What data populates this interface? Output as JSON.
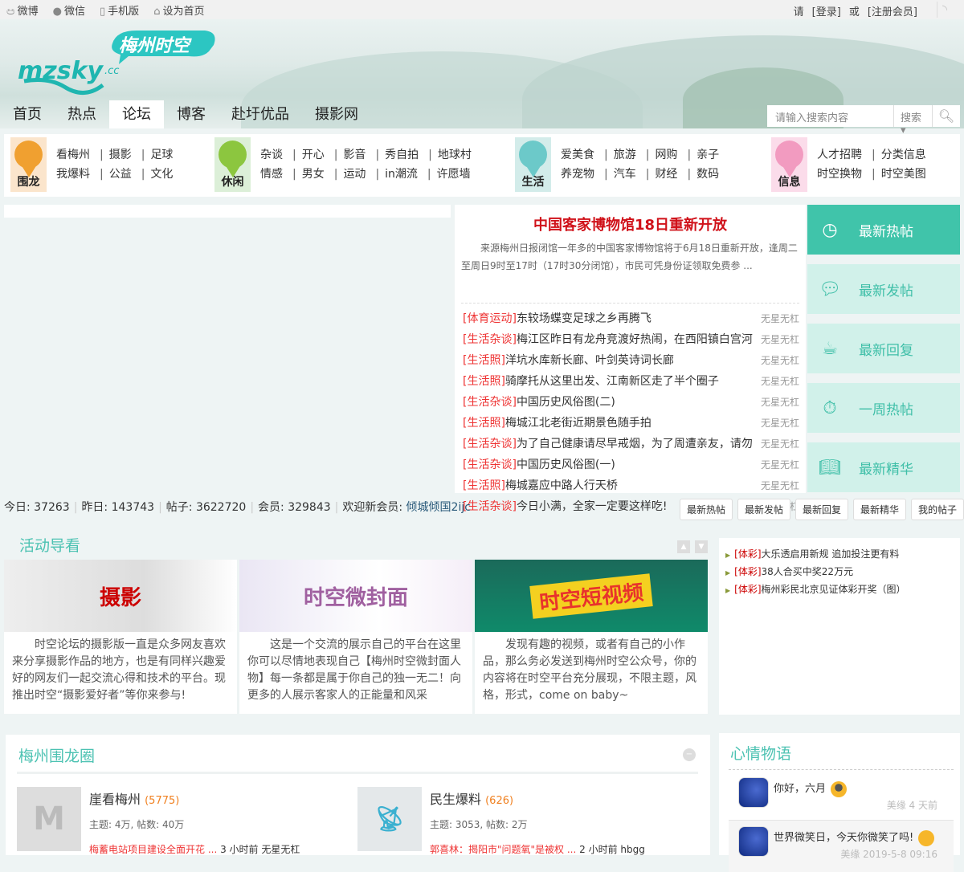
{
  "topbar": {
    "links": [
      "微博",
      "微信",
      "手机版",
      "设为首页"
    ],
    "icons": [
      "weibo-icon",
      "wechat-icon",
      "mobile-icon",
      "home-icon"
    ],
    "login_pre": "请",
    "login": "[登录]",
    "or": "或",
    "register": "[注册会员]"
  },
  "logo": {
    "text": "mzsky",
    "domain": ".cc",
    "cn": "梅州时空"
  },
  "nav": [
    "首页",
    "热点",
    "论坛",
    "博客",
    "赴圩优品",
    "摄影网"
  ],
  "search": {
    "placeholder": "请输入搜索内容",
    "type": "搜索"
  },
  "categories": [
    {
      "label": "围龙",
      "color": "#f0a030",
      "bg": "#fbe5cc",
      "rows": [
        [
          "看梅州",
          "摄影",
          "足球"
        ],
        [
          "我爆料",
          "公益",
          "文化"
        ]
      ]
    },
    {
      "label": "休闲",
      "color": "#8cc63f",
      "bg": "#dcefd8",
      "rows": [
        [
          "杂谈",
          "开心",
          "影音",
          "秀自拍",
          "地球村"
        ],
        [
          "情感",
          "男女",
          "运动",
          "in潮流",
          "许愿墙"
        ]
      ]
    },
    {
      "label": "生活",
      "color": "#6cc9c9",
      "bg": "#d3ecea",
      "rows": [
        [
          "爱美食",
          "旅游",
          "网购",
          "亲子"
        ],
        [
          "养宠物",
          "汽车",
          "财经",
          "数码"
        ]
      ]
    },
    {
      "label": "信息",
      "color": "#f29bc0",
      "bg": "#fbdcea",
      "rows": [
        [
          "人才招聘",
          "分类信息"
        ],
        [
          "时空换物",
          "时空美图"
        ]
      ]
    }
  ],
  "headline": {
    "title": "中国客家博物馆18日重新开放",
    "summary": "来源梅州日报闭馆一年多的中国客家博物馆将于6月18日重新开放，逢周二至周日9时至17时（17时30分闭馆），市民可凭身份证领取免费参 ..."
  },
  "news": [
    {
      "tag": "[体育运动]",
      "title": "东较场蝶变足球之乡再腾飞",
      "author": "无星无杠"
    },
    {
      "tag": "[生活杂谈]",
      "title": "梅江区昨日有龙舟竞渡好热闹，在西阳镇白宫河",
      "author": "无星无杠"
    },
    {
      "tag": "[生活照]",
      "title": "洋坑水库新长廊、叶剑英诗词长廊",
      "author": "无星无杠"
    },
    {
      "tag": "[生活照]",
      "title": "骑摩托从这里出发、江南新区走了半个圈子",
      "author": "无星无杠"
    },
    {
      "tag": "[生活杂谈]",
      "title": "中国历史风俗图(二)",
      "author": "无星无杠"
    },
    {
      "tag": "[生活照]",
      "title": "梅城江北老街近期景色随手拍",
      "author": "无星无杠"
    },
    {
      "tag": "[生活杂谈]",
      "title": "为了自己健康请尽早戒烟，为了周遭亲友，请勿",
      "author": "无星无杠"
    },
    {
      "tag": "[生活杂谈]",
      "title": "中国历史风俗图(一)",
      "author": "无星无杠"
    },
    {
      "tag": "[生活照]",
      "title": "梅城嘉应中路人行天桥",
      "author": "无星无杠"
    },
    {
      "tag": "[生活杂谈]",
      "title": "今日小满，全家一定要这样吃!",
      "author": "无星无杠"
    }
  ],
  "right_tabs": [
    "最新热帖",
    "最新发帖",
    "最新回复",
    "一周热帖",
    "最新精华"
  ],
  "stats": {
    "today_label": "今日:",
    "today": "37263",
    "yesterday_label": "昨日:",
    "yesterday": "143743",
    "posts_label": "帖子:",
    "posts": "3622720",
    "members_label": "会员:",
    "members": "329843",
    "welcome_label": "欢迎新会员:",
    "newest": "倾城倾国2ijc"
  },
  "quick_buttons": [
    "最新热帖",
    "最新发帖",
    "最新回复",
    "最新精华",
    "我的帖子"
  ],
  "activity": {
    "title": "活动导看",
    "cards": [
      {
        "img_text": "摄影",
        "text": "时空论坛的摄影版一直是众多网友喜欢来分享摄影作品的地方，也是有同样兴趣爱好的网友们一起交流心得和技术的平台。现推出时空“摄影爱好者”等你来参与!"
      },
      {
        "img_text": "时空微封面",
        "text": "这是一个交流的展示自己的平台在这里你可以尽情地表现自己【梅州时空微封面人物】每一条都是属于你自己的独一无二！向更多的人展示客家人的正能量和风采"
      },
      {
        "img_text": "时空短视频",
        "text": "发现有趣的视频，或者有自己的小作品，那么务必发送到梅州时空公众号，你的内容将在时空平台充分展现，不限主题，风格，形式，come on baby~"
      }
    ]
  },
  "lottery": [
    {
      "tag": "[体彩]",
      "title": "大乐透启用新规 追加投注更有料"
    },
    {
      "tag": "[体彩]",
      "title": "38人合买中奖22万元"
    },
    {
      "tag": "[体彩]",
      "title": "梅州彩民北京见证体彩开奖（图）"
    }
  ],
  "circle": {
    "title": "梅州围龙圈",
    "forums": [
      {
        "name": "崖看梅州",
        "count": "(5775)",
        "stats": "主题: 4万, 帖数: 40万",
        "last": "梅蓄电站项目建设全面开花 ...",
        "time": "3 小时前",
        "user": "无星无杠"
      },
      {
        "name": "民生爆料",
        "count": "(626)",
        "stats": "主题: 3053, 帖数: 2万",
        "last": "郭喜林：揭阳市\"问题氧\"是被权 ...",
        "time": "2 小时前",
        "user": "hbgg"
      }
    ]
  },
  "mood": {
    "title": "心情物语",
    "items": [
      {
        "text": "你好，六月",
        "meta": "美缘 4 天前"
      },
      {
        "text": "世界微笑日，今天你微笑了吗!",
        "meta": "美缘 2019-5-8 09:16"
      }
    ]
  }
}
